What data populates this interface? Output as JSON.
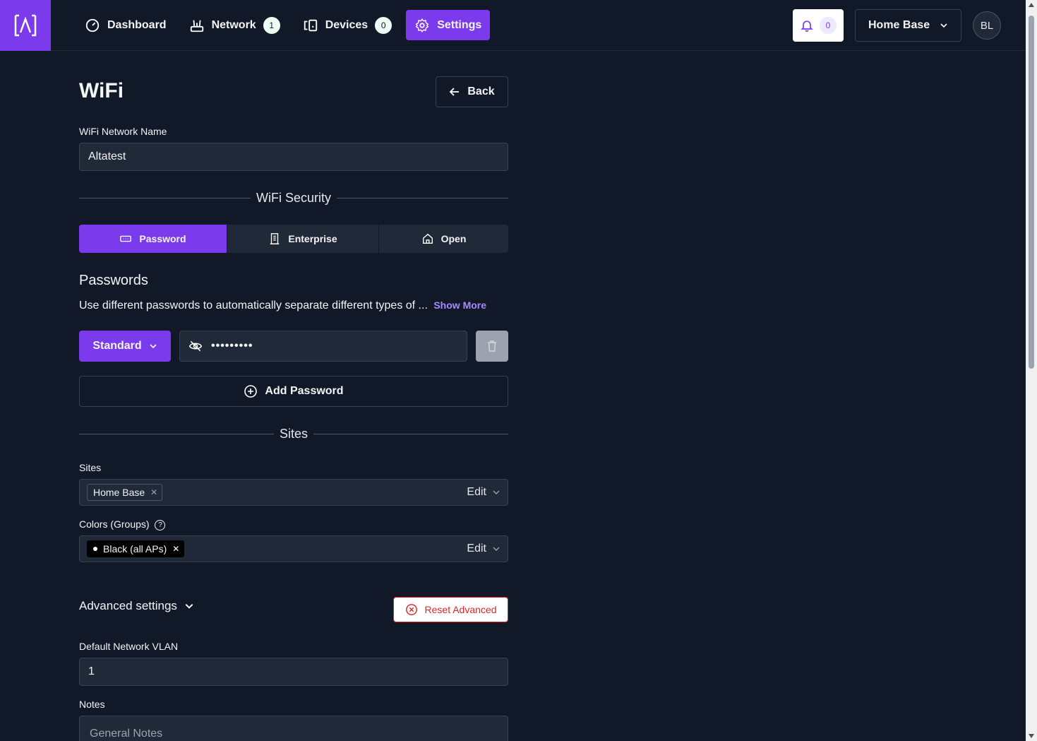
{
  "nav": {
    "items": [
      {
        "label": "Dashboard",
        "icon": "gauge-icon",
        "badge": ""
      },
      {
        "label": "Network",
        "icon": "router-icon",
        "badge": "1"
      },
      {
        "label": "Devices",
        "icon": "devices-icon",
        "badge": "0"
      },
      {
        "label": "Settings",
        "icon": "gear-icon",
        "badge": "",
        "active": true
      }
    ],
    "notifications_count": "0",
    "site": "Home Base",
    "avatar": "BL"
  },
  "page": {
    "title": "WiFi",
    "back_label": "Back"
  },
  "form": {
    "network_name_label": "WiFi Network Name",
    "network_name_value": "Altatest",
    "security_heading": "WiFi Security",
    "security_options": [
      "Password",
      "Enterprise",
      "Open"
    ],
    "security_selected": "Password",
    "passwords_title": "Passwords",
    "passwords_desc": "Use different passwords to automatically separate different types of ...",
    "show_more": "Show More",
    "password_type": "Standard",
    "password_value": "•••••••••",
    "add_password": "Add Password",
    "sites_heading": "Sites",
    "sites_label": "Sites",
    "sites_chip": "Home Base",
    "edit_label": "Edit",
    "colors_label": "Colors (Groups)",
    "colors_chip": "Black (all APs)",
    "advanced_label": "Advanced settings",
    "reset_advanced": "Reset Advanced",
    "vlan_label": "Default Network VLAN",
    "vlan_value": "1",
    "notes_label": "Notes",
    "notes_placeholder": "General Notes"
  },
  "colors": {
    "accent": "#7c3aed",
    "background": "#111827",
    "danger": "#dc2626"
  }
}
